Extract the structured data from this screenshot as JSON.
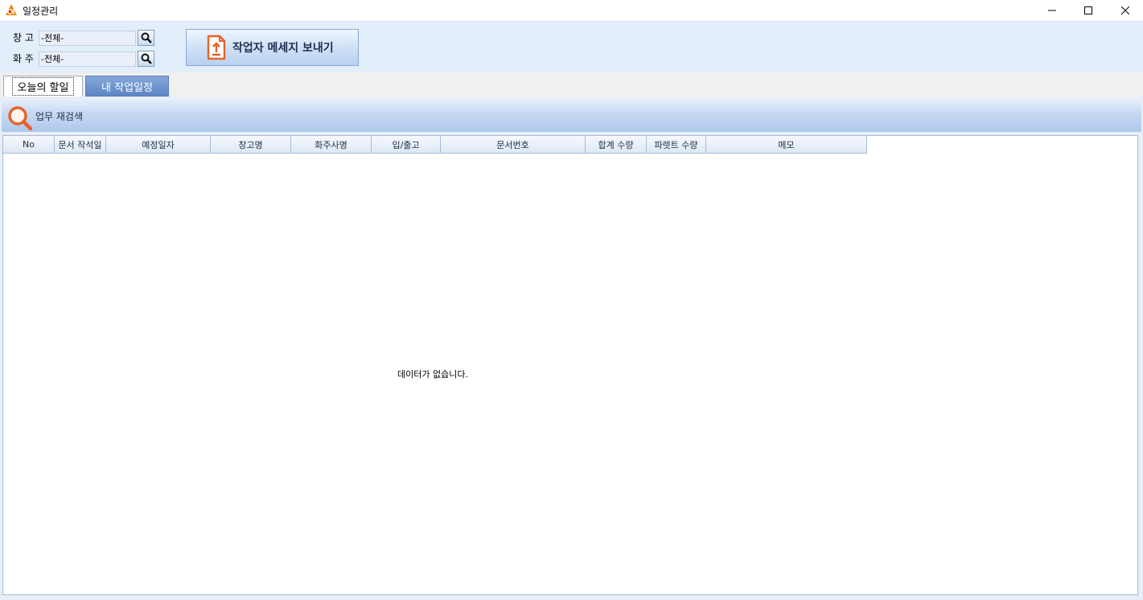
{
  "window": {
    "title": "일정관리",
    "controls": [
      "minimize-icon",
      "maximize-icon",
      "close-icon"
    ]
  },
  "filters": {
    "warehouse": {
      "label": "창 고",
      "value": "-전체-"
    },
    "shipper": {
      "label": "화 주",
      "value": "-전체-"
    }
  },
  "toolbar": {
    "send_message_label": "작업자 메세지 보내기"
  },
  "tabs": [
    {
      "label": "오늘의 할일",
      "active": true
    },
    {
      "label": "내 작업일정",
      "active": false
    }
  ],
  "panel": {
    "search_label": "업무 재검색"
  },
  "table": {
    "columns": [
      "No",
      "문서 작석일",
      "예정일자",
      "창고명",
      "화주사명",
      "입/출고",
      "문서번호",
      "합계 수량",
      "파렛트 수량",
      "메모"
    ],
    "rows": [],
    "empty_message": "데이터가 없습니다."
  },
  "colors": {
    "accent": "#e8622a",
    "toolbar_bg": "#e3eefb",
    "inactive_tab": "#6a8fcc"
  }
}
